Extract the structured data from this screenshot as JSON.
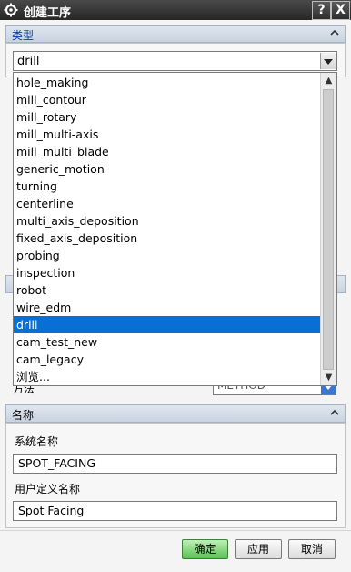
{
  "window": {
    "title": "创建工序"
  },
  "titlebar": {
    "help_label": "?",
    "close_label": "X"
  },
  "type_section": {
    "header": "类型",
    "selected_value": "drill",
    "options": [
      "hole_making",
      "mill_contour",
      "mill_rotary",
      "mill_multi-axis",
      "mill_multi_blade",
      "generic_motion",
      "turning",
      "centerline",
      "multi_axis_deposition",
      "fixed_axis_deposition",
      "probing",
      "inspection",
      "robot",
      "wire_edm",
      "drill",
      "cam_test_new",
      "cam_legacy",
      "浏览..."
    ],
    "highlighted_option": "drill"
  },
  "method_row": {
    "label": "方法",
    "value": "METHOD"
  },
  "name_section": {
    "header": "名称",
    "system_name_label": "系统名称",
    "system_name_value": "SPOT_FACING",
    "user_name_label": "用户定义名称",
    "user_name_value": "Spot Facing"
  },
  "buttons": {
    "ok": "确定",
    "apply": "应用",
    "cancel": "取消"
  },
  "colors": {
    "accent": "#0a6fd4",
    "ok_button": "#59c152",
    "section_label": "#0a3aa8"
  },
  "icons": {
    "gear": "gear-icon",
    "dropdown": "chevron-down-icon",
    "collapse": "chevron-up-icon"
  }
}
